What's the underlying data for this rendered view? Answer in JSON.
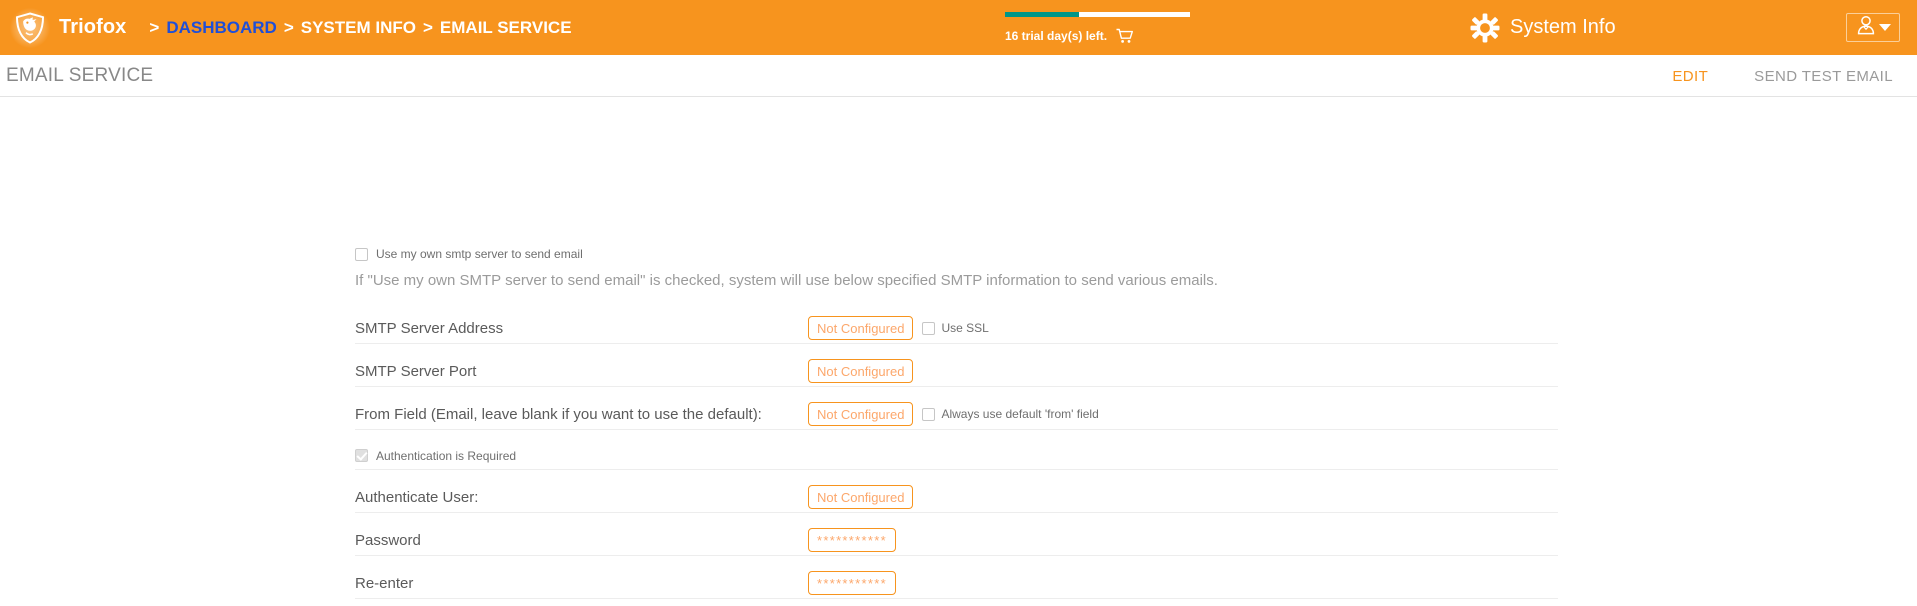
{
  "topbar": {
    "brand_name": "Triofox",
    "logo_icon": "shield-fox-logo-icon",
    "breadcrumb": {
      "separator": ">",
      "items": [
        {
          "label": "DASHBOARD",
          "is_link": true
        },
        {
          "label": "SYSTEM INFO",
          "is_link": false
        },
        {
          "label": "EMAIL SERVICE",
          "is_link": false
        }
      ]
    },
    "trial": {
      "text": "16 trial day(s) left.",
      "progress_percent": 40,
      "progress_fill_color": "#009688",
      "progress_track_color": "#ffffff",
      "cart_icon": "shopping-cart-icon"
    },
    "system_info": {
      "label": "System Info",
      "gear_icon": "gear-icon"
    },
    "user_menu": {
      "avatar_icon": "user-avatar-icon",
      "caret_icon": "chevron-down-icon"
    },
    "background_color": "#f7941e"
  },
  "subheader": {
    "title": "EMAIL SERVICE",
    "actions": [
      {
        "label": "EDIT",
        "accent": true
      },
      {
        "label": "SEND TEST EMAIL",
        "accent": false
      }
    ],
    "accent_color": "#f7941e"
  },
  "form": {
    "own_smtp": {
      "label": "Use my own smtp server to send email",
      "checked": false
    },
    "hint": "If \"Use my own SMTP server to send email\" is checked, system will use below specified SMTP information to send various emails.",
    "rows": [
      {
        "label": "SMTP Server Address",
        "value": "Not Configured",
        "checkbox_label": "Use SSL",
        "checkbox_checked": false
      },
      {
        "label": "SMTP Server Port",
        "value": "Not Configured",
        "checkbox_label": "",
        "checkbox_checked": false
      },
      {
        "label": "From Field (Email, leave blank if you want to use the default):",
        "value": "Not Configured",
        "checkbox_label": "Always use default 'from' field",
        "checkbox_checked": false
      }
    ],
    "auth_required": {
      "label": "Authentication is Required",
      "checked": true,
      "disabled": true
    },
    "auth_rows": [
      {
        "label": "Authenticate User:",
        "value": "Not Configured",
        "is_password": false
      },
      {
        "label": "Password",
        "value": "***********",
        "is_password": true
      },
      {
        "label": "Re-enter",
        "value": "***********",
        "is_password": true
      }
    ],
    "field_border_color": "#f7941e",
    "field_text_color": "#fca76b"
  }
}
